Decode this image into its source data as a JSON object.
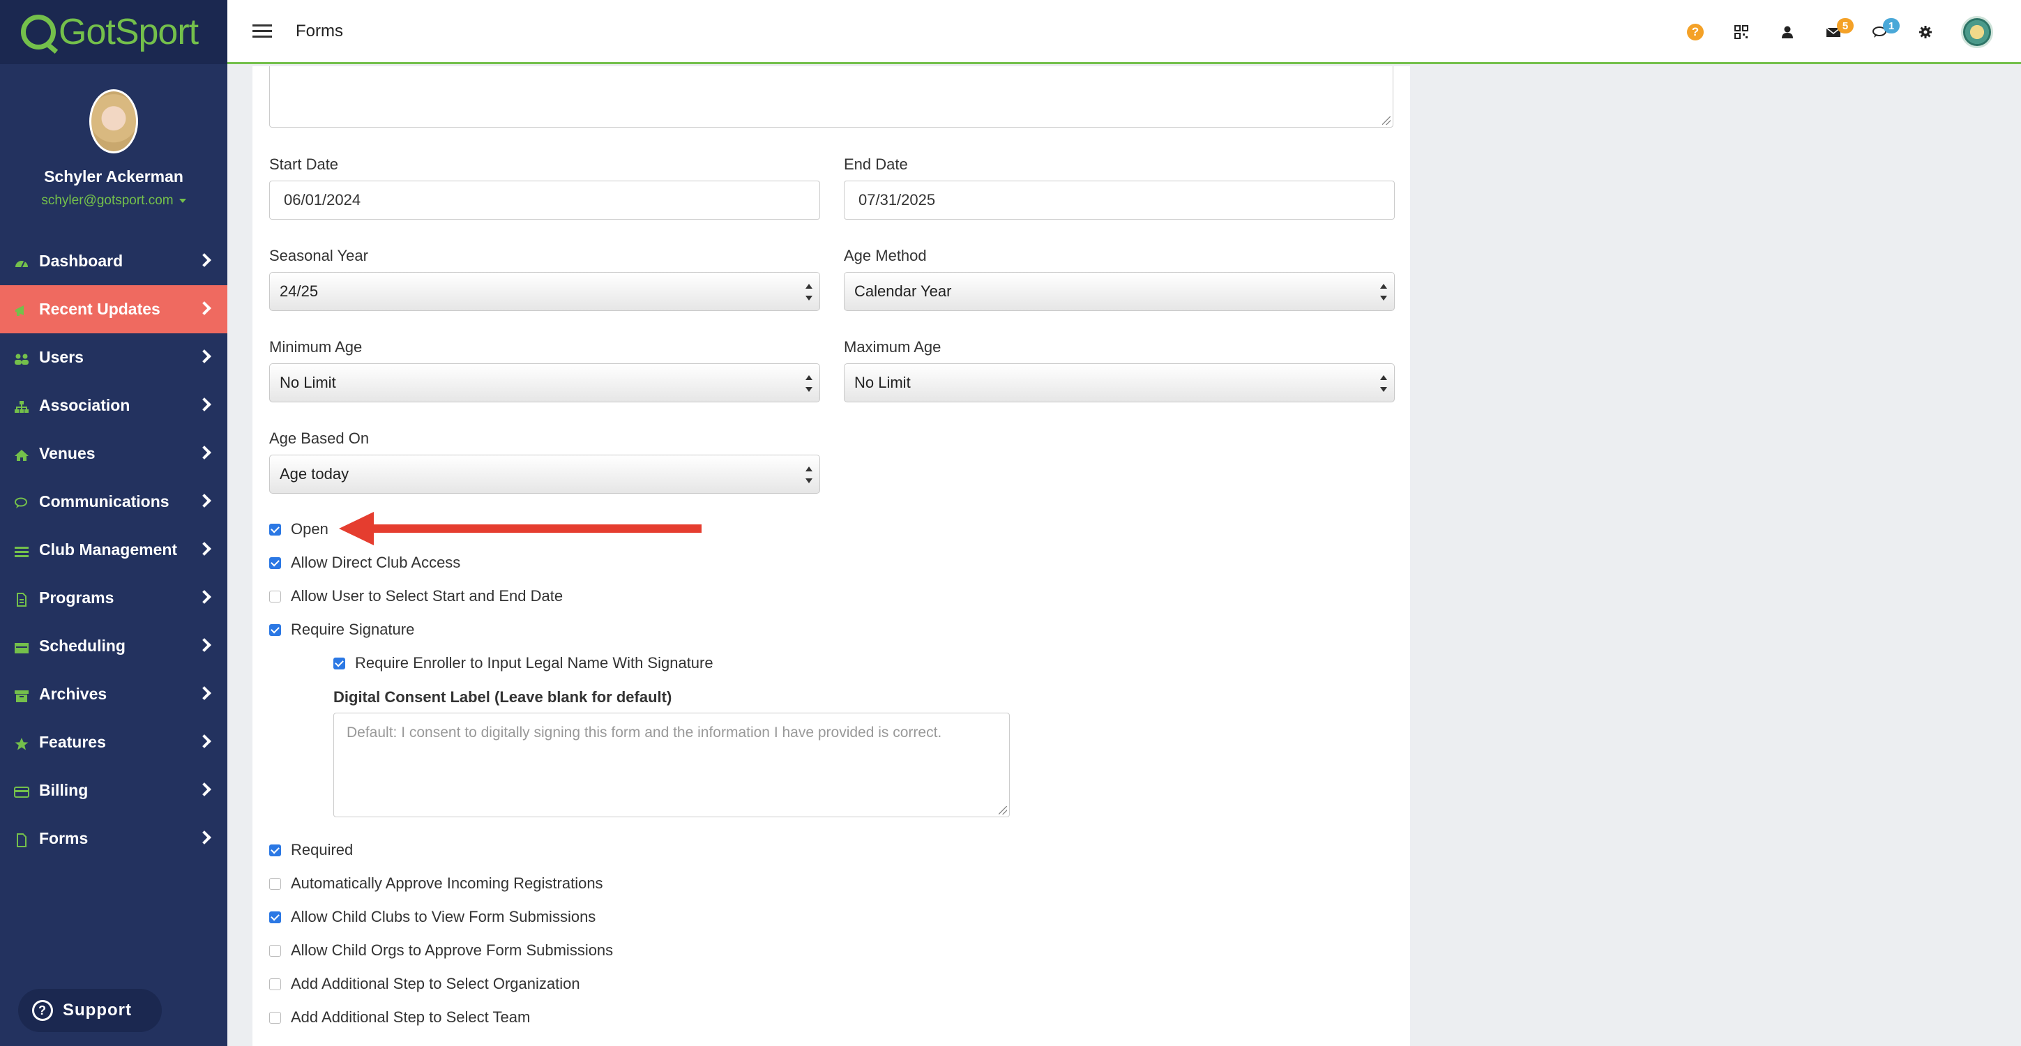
{
  "app": {
    "logo_text": "GotSport"
  },
  "profile": {
    "name": "Schyler Ackerman",
    "email": "schyler@gotsport.com"
  },
  "sidebar": {
    "items": [
      {
        "label": "Dashboard",
        "icon": "dashboard-icon"
      },
      {
        "label": "Recent Updates",
        "icon": "megaphone-icon",
        "active": true
      },
      {
        "label": "Users",
        "icon": "users-icon"
      },
      {
        "label": "Association",
        "icon": "sitemap-icon"
      },
      {
        "label": "Venues",
        "icon": "home-icon"
      },
      {
        "label": "Communications",
        "icon": "comments-icon"
      },
      {
        "label": "Club Management",
        "icon": "list-icon"
      },
      {
        "label": "Programs",
        "icon": "document-icon"
      },
      {
        "label": "Scheduling",
        "icon": "calendar-icon"
      },
      {
        "label": "Archives",
        "icon": "archive-icon"
      },
      {
        "label": "Features",
        "icon": "star-icon"
      },
      {
        "label": "Billing",
        "icon": "credit-card-icon"
      },
      {
        "label": "Forms",
        "icon": "file-icon"
      }
    ],
    "support_label": "Support"
  },
  "header": {
    "title": "Forms",
    "mail_badge": "5",
    "chat_badge": "1"
  },
  "form": {
    "start_date": {
      "label": "Start Date",
      "value": "06/01/2024"
    },
    "end_date": {
      "label": "End Date",
      "value": "07/31/2025"
    },
    "seasonal_year": {
      "label": "Seasonal Year",
      "value": "24/25"
    },
    "age_method": {
      "label": "Age Method",
      "value": "Calendar Year"
    },
    "minimum_age": {
      "label": "Minimum Age",
      "value": "No Limit"
    },
    "maximum_age": {
      "label": "Maximum Age",
      "value": "No Limit"
    },
    "age_based_on": {
      "label": "Age Based On",
      "value": "Age today"
    },
    "checkboxes": [
      {
        "label": "Open",
        "checked": true
      },
      {
        "label": "Allow Direct Club Access",
        "checked": true
      },
      {
        "label": "Allow User to Select Start and End Date",
        "checked": false
      },
      {
        "label": "Require Signature",
        "checked": true
      }
    ],
    "legal_name": {
      "label": "Require Enroller to Input Legal Name With Signature",
      "checked": true
    },
    "consent": {
      "label": "Digital Consent Label (Leave blank for default)",
      "placeholder": "Default: I consent to digitally signing this form and the information I have provided is correct."
    },
    "checkboxes_bottom": [
      {
        "label": "Required",
        "checked": true
      },
      {
        "label": "Automatically Approve Incoming Registrations",
        "checked": false
      },
      {
        "label": "Allow Child Clubs to View Form Submissions",
        "checked": true
      },
      {
        "label": "Allow Child Orgs to Approve Form Submissions",
        "checked": false
      },
      {
        "label": "Add Additional Step to Select Organization",
        "checked": false
      },
      {
        "label": "Add Additional Step to Select Team",
        "checked": false
      }
    ]
  },
  "colors": {
    "sidebar": "#23325f",
    "active": "#ef6a60",
    "brand_green": "#74c04b",
    "arrow": "#e53d2f",
    "checkbox": "#2b78e4"
  }
}
